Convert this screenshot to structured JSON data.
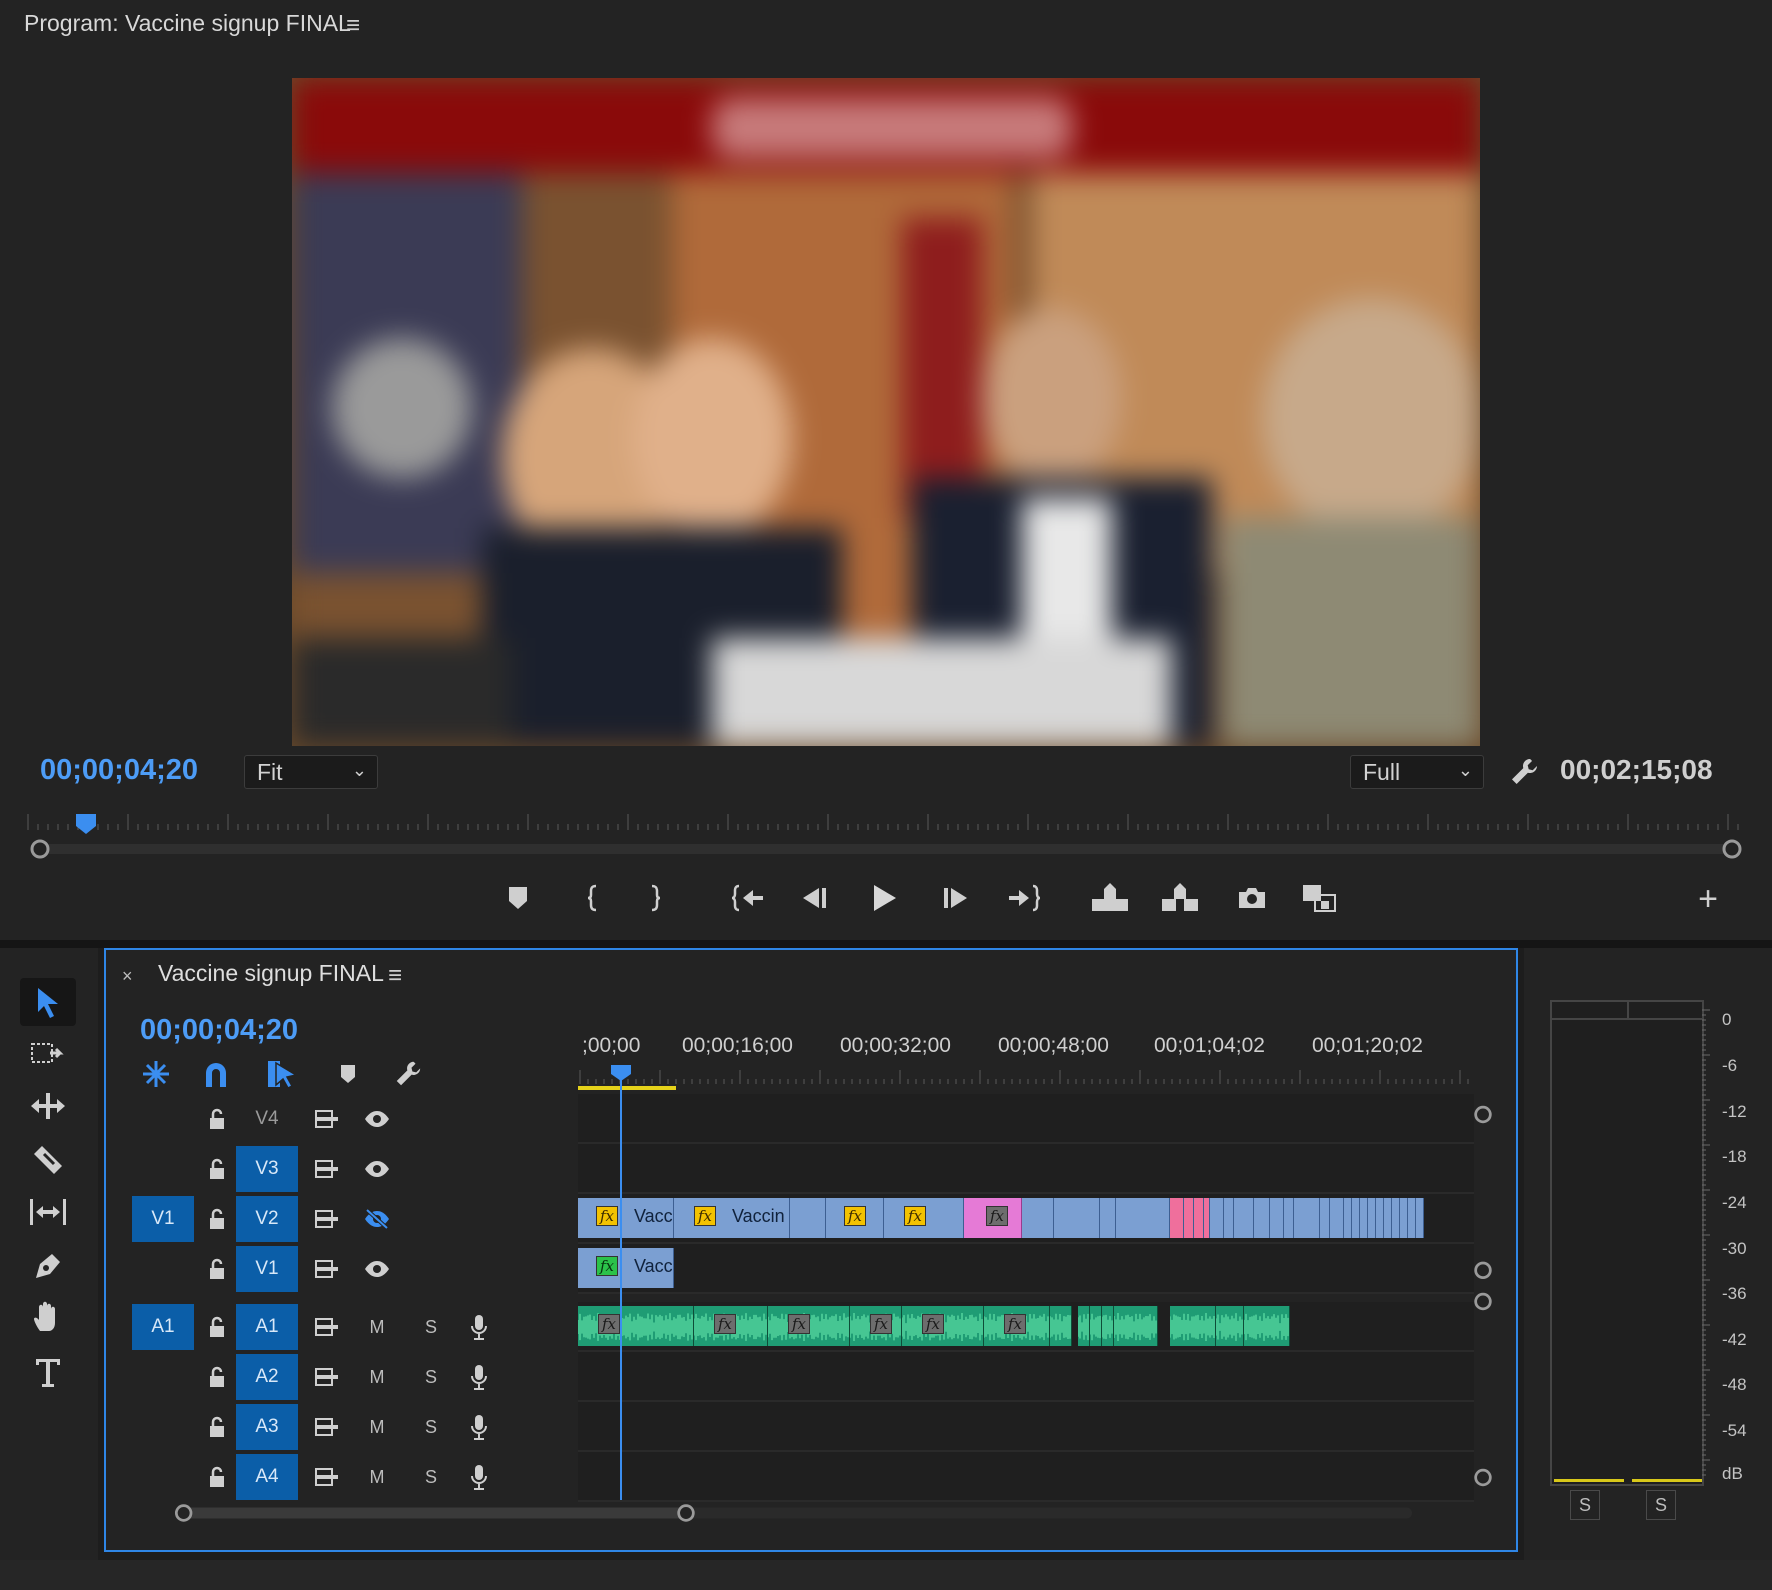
{
  "program_monitor": {
    "title": "Program: Vaccine signup FINAL",
    "menu_glyph": "≡",
    "current_timecode": "00;00;04;20",
    "zoom_dropdown": "Fit",
    "resolution_dropdown": "Full",
    "duration_timecode": "00;02;15;08",
    "add_glyph": "+"
  },
  "timeline": {
    "close_glyph": "×",
    "title": "Vaccine signup FINAL",
    "menu_glyph": "≡",
    "current_timecode": "00;00;04;20",
    "ruler_labels": [
      ";00;00",
      "00;00;16;00",
      "00;00;32;00",
      "00;00;48;00",
      "00;01;04;02",
      "00;01;20;02"
    ],
    "video_tracks": [
      {
        "name": "V4",
        "source": "",
        "targeted": false,
        "visible": true
      },
      {
        "name": "V3",
        "source": "",
        "targeted": true,
        "visible": true
      },
      {
        "name": "V2",
        "source": "V1",
        "targeted": true,
        "visible": false
      },
      {
        "name": "V1",
        "source": "",
        "targeted": true,
        "visible": true
      }
    ],
    "audio_tracks": [
      {
        "name": "A1",
        "source": "A1",
        "targeted": true,
        "mute_label": "M",
        "solo_label": "S"
      },
      {
        "name": "A2",
        "source": "",
        "targeted": true,
        "mute_label": "M",
        "solo_label": "S"
      },
      {
        "name": "A3",
        "source": "",
        "targeted": true,
        "mute_label": "M",
        "solo_label": "S"
      },
      {
        "name": "A4",
        "source": "",
        "targeted": true,
        "mute_label": "M",
        "solo_label": "S"
      }
    ],
    "clips": {
      "v2_clip_1": "Vacc",
      "v2_clip_2": "Vaccin",
      "v1_clip_1": "Vacc"
    },
    "fx_label": "fx"
  },
  "audio_meter": {
    "scale": [
      "0",
      "-6",
      "-12",
      "-18",
      "-24",
      "-30",
      "-36",
      "-42",
      "-48",
      "-54",
      "dB"
    ],
    "solo_labels": [
      "S",
      "S"
    ]
  },
  "colors": {
    "accent_blue": "#4d9cf6",
    "track_target": "#0b5ea8",
    "video_clip": "#7b9fd2",
    "audio_clip": "#1f9c74",
    "pink_clip": "#e57ad6"
  },
  "icons": [
    "marker-icon",
    "mark-in-icon",
    "mark-out-icon",
    "go-to-in-icon",
    "step-back-icon",
    "play-icon",
    "step-forward-icon",
    "go-to-out-icon",
    "lift-icon",
    "extract-icon",
    "camera-icon",
    "compare-icon",
    "wrench-icon",
    "selection-tool-icon",
    "track-select-tool-icon",
    "ripple-edit-tool-icon",
    "razor-tool-icon",
    "slip-tool-icon",
    "pen-tool-icon",
    "hand-tool-icon",
    "type-tool-icon",
    "lock-icon",
    "sync-lock-icon",
    "eye-icon",
    "microphone-icon"
  ]
}
